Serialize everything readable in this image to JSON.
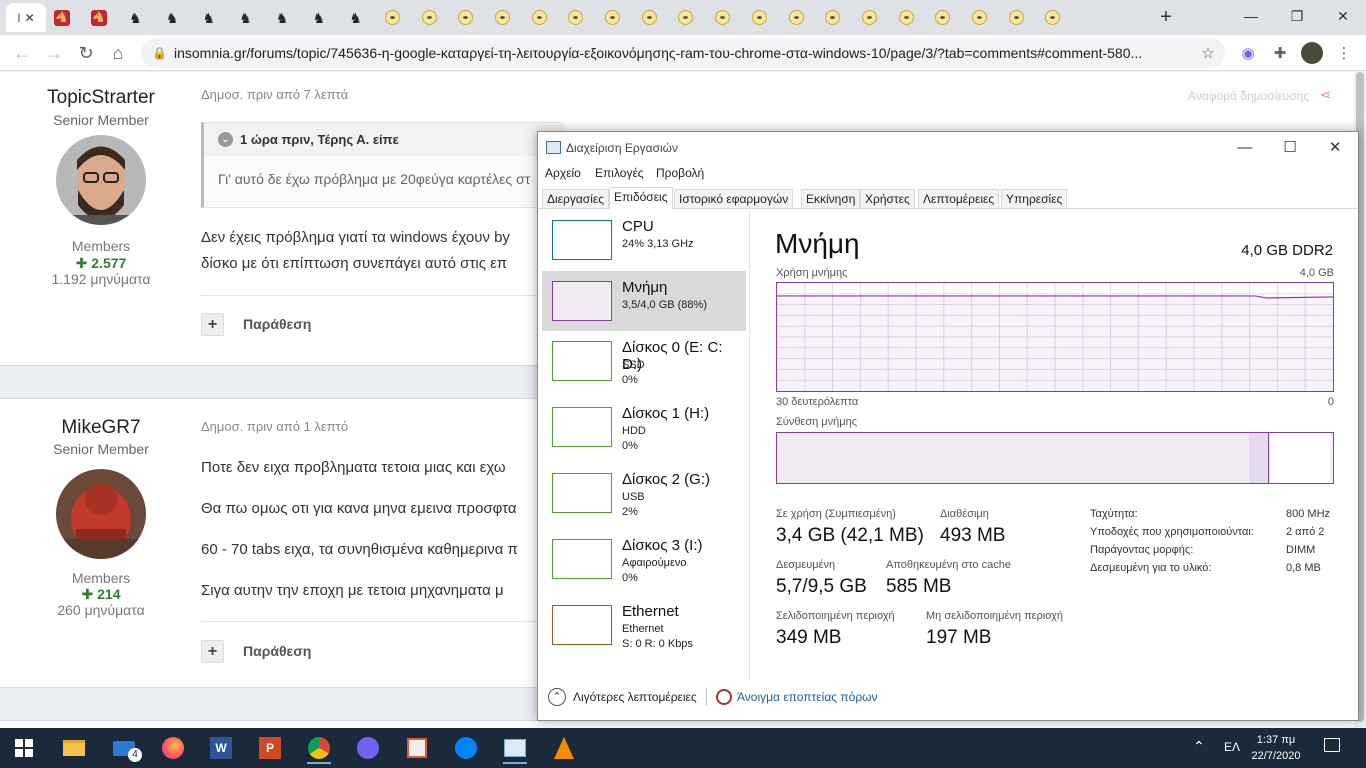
{
  "browser": {
    "tabs": {
      "active_tab_text": "I",
      "favicons": [
        "red",
        "red",
        "black",
        "black",
        "black",
        "black",
        "black",
        "black",
        "black",
        "minion",
        "minion",
        "minion",
        "minion",
        "minion",
        "minion",
        "minion",
        "minion",
        "minion",
        "minion",
        "minion",
        "minion",
        "minion",
        "minion",
        "minion",
        "minion",
        "minion",
        "minion",
        "minion"
      ]
    },
    "new_tab_label": "+",
    "url": "insomnia.gr/forums/topic/745636-η-google-καταργεί-τη-λειτουργία-εξοικονόμησης-ram-του-chrome-στα-windows-10/page/3/?tab=comments#comment-580..."
  },
  "posts": [
    {
      "username": "TopicStrarter",
      "rank": "Senior Member",
      "group": "Members",
      "reputation": "2.577",
      "post_count": "1.192 μηνύματα",
      "date": "Δημοσ. πριν από 7 λεπτά",
      "quote_header": "1 ώρα πριν, Τέρης Α. είπε",
      "quote_body": "Γι' αυτό δε έχω πρόβλημα με 20φεύγα καρτέλες στ",
      "lines": [
        "Δεν έχεις πρόβλημα γιατί τα windows έχουν by",
        "δίσκο με ότι επίπτωση συνεπάγει αυτό στις επ"
      ],
      "quote_button": "Παράθεση",
      "share_text": "Αναφορά δημοσίευσης"
    },
    {
      "username": "MikeGR7",
      "rank": "Senior Member",
      "group": "Members",
      "reputation": "214",
      "post_count": "260 μηνύματα",
      "date": "Δημοσ. πριν από 1 λεπτό",
      "lines": [
        "Ποτε δεν ειχα προβληματα τετοια μιας και εχω",
        "Θα πω ομως οτι για κανα μηνα εμεινα προσφτα",
        "60 - 70 tabs ειχα, τα συνηθισμένα καθημερινα π",
        "Σιγα αυτην την εποχη με τετοια μηχανηματα μ"
      ],
      "quote_button": "Παράθεση"
    }
  ],
  "task_manager": {
    "title": "Διαχείριση Εργασιών",
    "menu": [
      "Αρχείο",
      "Επιλογές",
      "Προβολή"
    ],
    "tabs": [
      "Διεργασίες",
      "Επιδόσεις",
      "Ιστορικό εφαρμογών",
      "Εκκίνηση",
      "Χρήστες",
      "Λεπτομέρειες",
      "Υπηρεσίες"
    ],
    "selected_tab": "Επιδόσεις",
    "resources": [
      {
        "name": "CPU",
        "line2": "24% 3,13 GHz",
        "line3": "",
        "color": "#1171b8"
      },
      {
        "name": "Μνήμη",
        "line2": "3,5/4,0 GB (88%)",
        "line3": "",
        "color": "#8b3ba6"
      },
      {
        "name": "Δίσκος 0 (E: C: D:)",
        "line2": "SSD",
        "line3": "0%",
        "color": "#4ea531"
      },
      {
        "name": "Δίσκος 1 (H:)",
        "line2": "HDD",
        "line3": "0%",
        "color": "#4ea531"
      },
      {
        "name": "Δίσκος 2 (G:)",
        "line2": "USB",
        "line3": "2%",
        "color": "#4ea531"
      },
      {
        "name": "Δίσκος 3 (I:)",
        "line2": "Αφαιρούμενο",
        "line3": "0%",
        "color": "#4ea531"
      },
      {
        "name": "Ethernet",
        "line2": "Ethernet",
        "line3": "S: 0 R: 0 Kbps",
        "color": "#a7541d"
      }
    ],
    "memory": {
      "title": "Μνήμη",
      "total": "4,0 GB DDR2",
      "usage_label": "Χρήση μνήμης",
      "usage_max": "4,0 GB",
      "time_label": "30 δευτερόλεπτα",
      "time_end": "0",
      "composition_label": "Σύνθεση μνήμης",
      "usage_fraction": 0.88,
      "stats": {
        "in_use_label": "Σε χρήση (Συμπιεσμένη)",
        "in_use": "3,4 GB (42,1 MB)",
        "available_label": "Διαθέσιμη",
        "available": "493 MB",
        "committed_label": "Δεσμευμένη",
        "committed": "5,7/9,5 GB",
        "cached_label": "Αποθηκευμένη στο cache",
        "cached": "585 MB",
        "paged_label": "Σελιδοποιημένη περιοχή",
        "paged": "349 MB",
        "nonpaged_label": "Μη σελιδοποιημένη περιοχή",
        "nonpaged": "197 MB"
      },
      "details": [
        {
          "k": "Ταχύτητα:",
          "v": "800 MHz"
        },
        {
          "k": "Υποδοχές που χρησιμοποιούνται:",
          "v": "2 από 2"
        },
        {
          "k": "Παράγοντας μορφής:",
          "v": "DIMM"
        },
        {
          "k": "Δεσμευμένη για το υλικό:",
          "v": "0,8 MB"
        }
      ]
    },
    "fewer_details": "Λιγότερες λεπτομέρειες",
    "open_resmon": "Άνοιγμα εποπτείας πόρων"
  },
  "taskbar": {
    "mail_badge": "4",
    "language": "ΕΛ",
    "time": "1:37 πμ",
    "date": "22/7/2020"
  }
}
